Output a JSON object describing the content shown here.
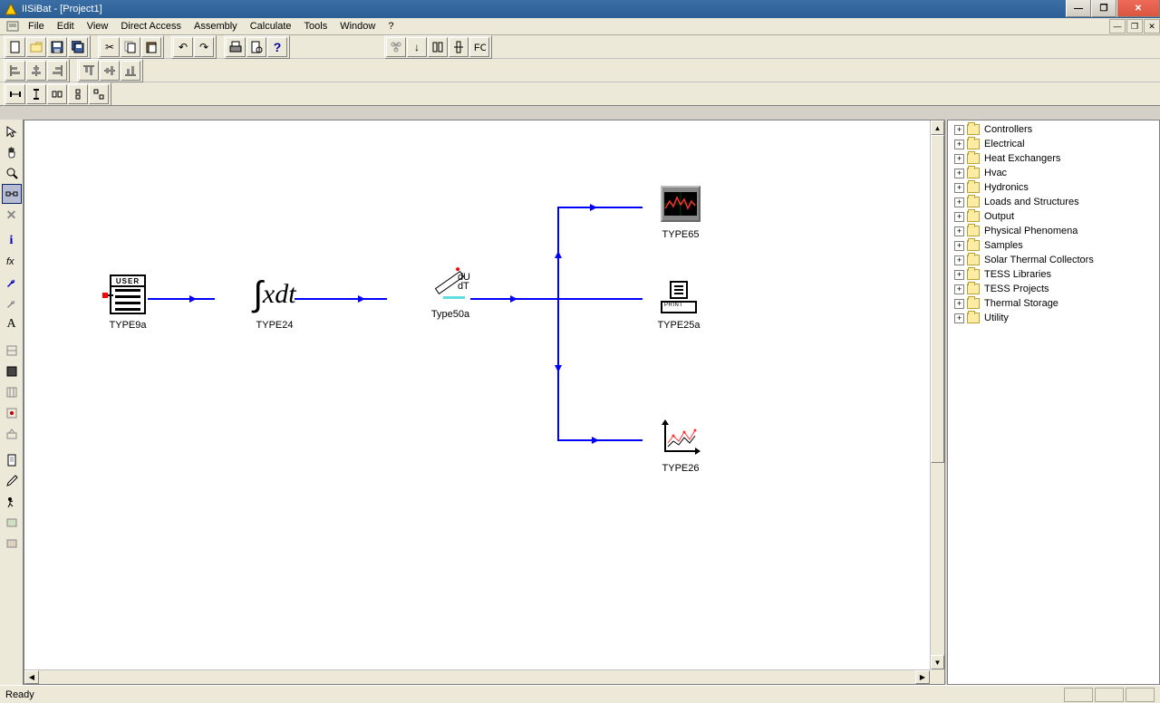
{
  "window": {
    "title": "IISiBat - [Project1]"
  },
  "menu": {
    "file": "File",
    "edit": "Edit",
    "view": "View",
    "direct": "Direct Access",
    "assembly": "Assembly",
    "calculate": "Calculate",
    "tools": "Tools",
    "window": "Window",
    "help": "?"
  },
  "tree": {
    "items": [
      {
        "label": "Controllers"
      },
      {
        "label": "Electrical"
      },
      {
        "label": "Heat Exchangers"
      },
      {
        "label": "Hvac"
      },
      {
        "label": "Hydronics"
      },
      {
        "label": "Loads and Structures"
      },
      {
        "label": "Output"
      },
      {
        "label": "Physical Phenomena"
      },
      {
        "label": "Samples"
      },
      {
        "label": "Solar Thermal Collectors"
      },
      {
        "label": "TESS Libraries"
      },
      {
        "label": "TESS Projects"
      },
      {
        "label": "Thermal Storage"
      },
      {
        "label": "Utility"
      }
    ]
  },
  "nodes": {
    "n1": "TYPE9a",
    "n2": "TYPE24",
    "n3": "Type50a",
    "n4": "TYPE65",
    "n5": "TYPE25a",
    "n6": "TYPE26"
  },
  "user_icon_header": "USER",
  "pv_text1": "dU",
  "pv_text2": "dT",
  "status": "Ready"
}
